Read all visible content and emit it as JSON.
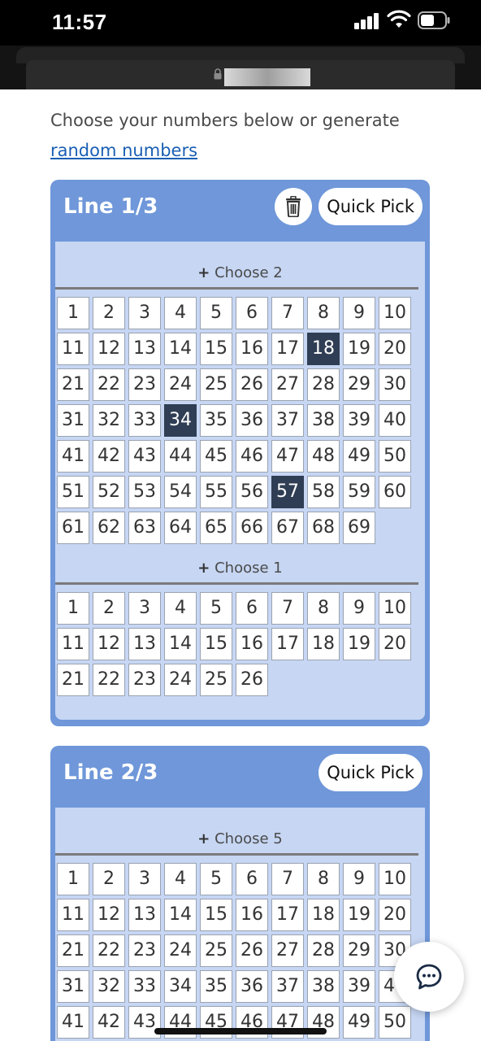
{
  "status_bar": {
    "time": "11:57"
  },
  "intro": {
    "text": "Choose your numbers below or generate",
    "link": "random numbers"
  },
  "lines": [
    {
      "title": "Line 1/3",
      "quick_pick": "Quick Pick",
      "has_delete": true,
      "sections": [
        {
          "label": "Choose 2",
          "count": 69,
          "selected": [
            18,
            34,
            57
          ]
        },
        {
          "label": "Choose 1",
          "count": 26,
          "selected": []
        }
      ]
    },
    {
      "title": "Line 2/3",
      "quick_pick": "Quick Pick",
      "has_delete": false,
      "sections": [
        {
          "label": "Choose 5",
          "count": 50,
          "selected": []
        }
      ]
    }
  ],
  "icons": {
    "delete": "trash-icon",
    "chat": "chat-bubble-icon",
    "lock": "lock-icon"
  },
  "colors": {
    "card": "#6f97d9",
    "card_body": "#c6d6f3",
    "selected_cell": "#2f3e54",
    "link": "#1a5fb4"
  }
}
